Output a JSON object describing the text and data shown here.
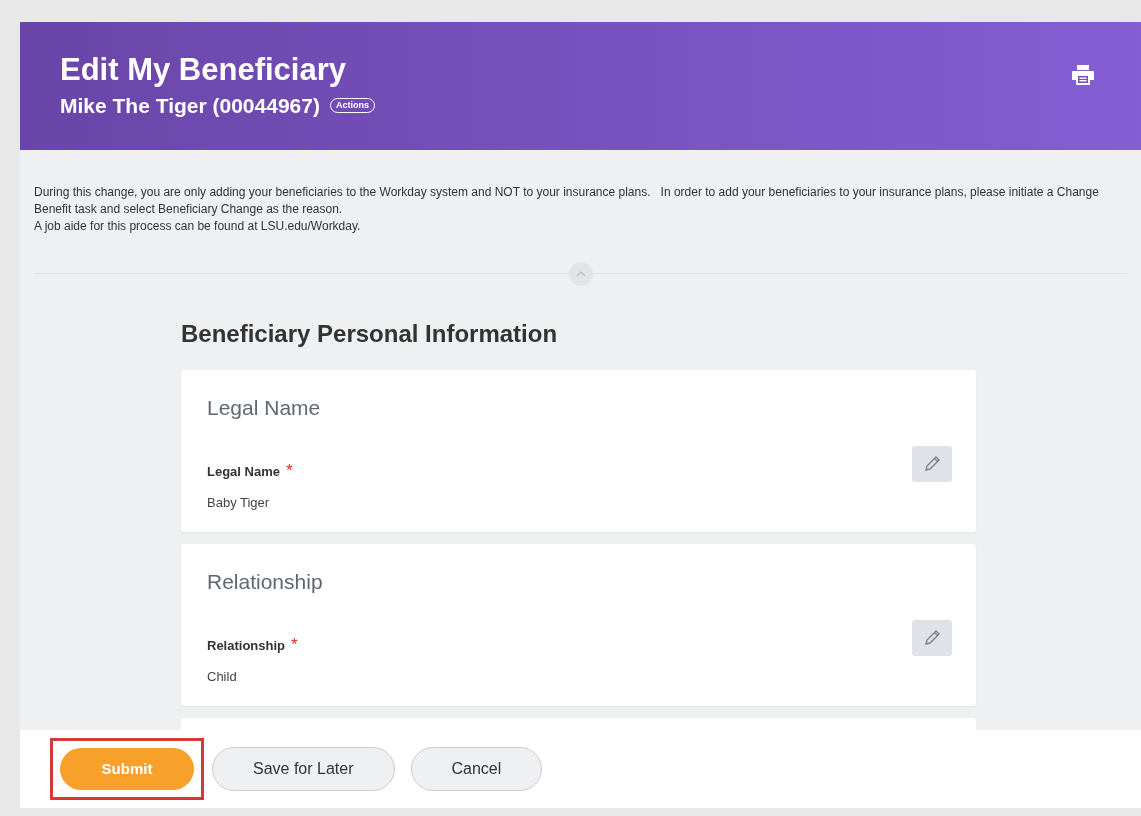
{
  "header": {
    "title": "Edit My Beneficiary",
    "subtitle": "Mike The Tiger (00044967)",
    "actions_label": "Actions"
  },
  "notice": {
    "lines": [
      "During this change, you are only adding your beneficiaries to the Workday system and NOT to your insurance plans.   In order to add your beneficiaries to your insurance plans, please initiate a Change Benefit task and select Beneficiary Change as the reason.",
      "A job aide for this process can be found at LSU.edu/Workday."
    ]
  },
  "section": {
    "title": "Beneficiary Personal Information",
    "cards": [
      {
        "title": "Legal Name",
        "field_label": "Legal Name",
        "required": true,
        "value": "Baby Tiger"
      },
      {
        "title": "Relationship",
        "field_label": "Relationship",
        "required": true,
        "value": "Child"
      }
    ]
  },
  "required_mark": "*",
  "buttons": [
    {
      "label": "Submit",
      "kind": "primary",
      "highlighted": true
    },
    {
      "label": "Save for Later",
      "kind": "secondary",
      "highlighted": false
    },
    {
      "label": "Cancel",
      "kind": "secondary",
      "highlighted": false
    }
  ]
}
